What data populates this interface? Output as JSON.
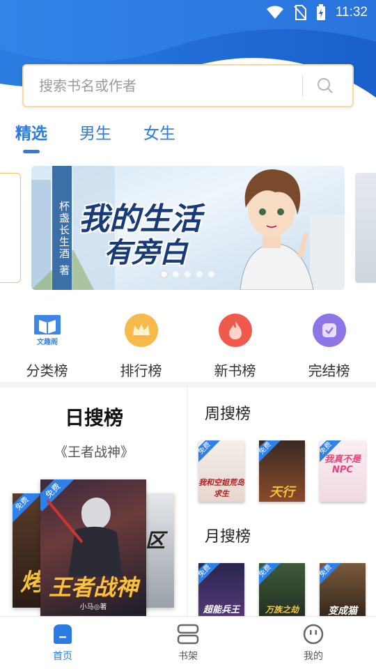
{
  "status_bar": {
    "time": "11:32"
  },
  "search": {
    "placeholder": "搜索书名或作者"
  },
  "tabs": [
    {
      "label": "精选",
      "active": true
    },
    {
      "label": "男生",
      "active": false
    },
    {
      "label": "女生",
      "active": false
    }
  ],
  "banner": {
    "author_line": "杯盏长生酒",
    "author_badge": "著",
    "title_line1": "我的生活",
    "title_line2": "有旁白",
    "slide_count": 5,
    "active_slide": 1
  },
  "categories": [
    {
      "label": "分类榜",
      "icon": "book-icon",
      "icon_text": "文趣阁"
    },
    {
      "label": "排行榜",
      "icon": "crown-icon"
    },
    {
      "label": "新书榜",
      "icon": "flame-icon"
    },
    {
      "label": "完结榜",
      "icon": "check-shield-icon"
    }
  ],
  "daily_rank": {
    "title": "日搜榜",
    "featured_book": "《王者战神》",
    "covers": [
      {
        "tag": "免费",
        "text": "王者战神",
        "byline": "小马◎著"
      },
      {
        "tag": "免费",
        "text": "烤"
      },
      {
        "tag": "",
        "text": "区"
      }
    ]
  },
  "weekly_rank": {
    "title": "周搜榜",
    "covers": [
      {
        "tag": "免费",
        "text": "我和空姐荒岛求生"
      },
      {
        "tag": "免费",
        "text": "天行"
      },
      {
        "tag": "免费",
        "text": "我真不是NPC"
      }
    ]
  },
  "monthly_rank": {
    "title": "月搜榜",
    "covers": [
      {
        "tag": "免费",
        "text": "超能兵王"
      },
      {
        "tag": "免费",
        "text": "万族之劫"
      },
      {
        "tag": "免费",
        "text": "变成猫"
      }
    ]
  },
  "bottom_nav": [
    {
      "label": "首页",
      "icon": "home-icon",
      "active": true
    },
    {
      "label": "书架",
      "icon": "bookshelf-icon",
      "active": false
    },
    {
      "label": "我的",
      "icon": "profile-icon",
      "active": false
    }
  ],
  "colors": {
    "accent": "#2c7be0",
    "free_tag": "#2f80e7",
    "header_blue": "#1f6fd8"
  }
}
